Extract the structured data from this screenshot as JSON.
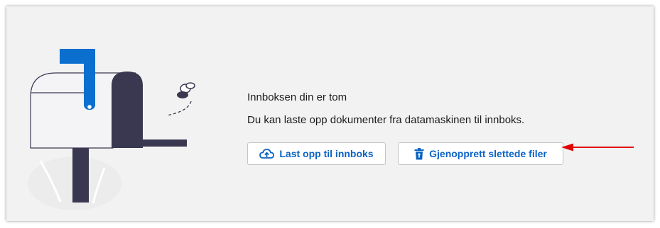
{
  "empty_state": {
    "title": "Innboksen din er tom",
    "description": "Du kan laste opp dokumenter fra datamaskinen til innboks."
  },
  "actions": {
    "upload_label": "Last opp til innboks",
    "restore_label": "Gjenopprett slettede filer"
  },
  "icons": {
    "upload": "cloud-upload-icon",
    "restore": "trash-restore-icon",
    "illustration": "empty-mailbox-illustration"
  },
  "colors": {
    "accent": "#0b63c4",
    "mailbox_dark": "#3a3850",
    "annotation_arrow": "#e00000"
  }
}
